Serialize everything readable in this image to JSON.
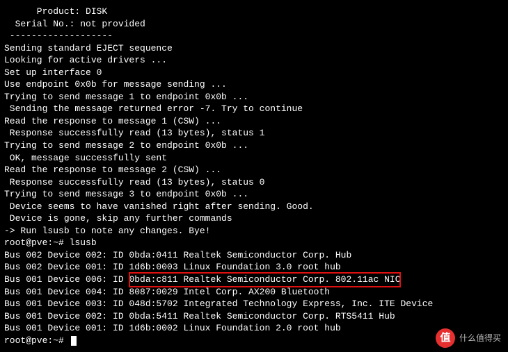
{
  "header": {
    "product": "      Product: DISK",
    "serial": "  Serial No.: not provided",
    "divider": " -------------------"
  },
  "log": [
    "Sending standard EJECT sequence",
    "Looking for active drivers ...",
    "Set up interface 0",
    "Use endpoint 0x0b for message sending ...",
    "Trying to send message 1 to endpoint 0x0b ...",
    " Sending the message returned error -7. Try to continue",
    "Read the response to message 1 (CSW) ...",
    " Response successfully read (13 bytes), status 1",
    "Trying to send message 2 to endpoint 0x0b ...",
    " OK, message successfully sent",
    "Read the response to message 2 (CSW) ...",
    " Response successfully read (13 bytes), status 0",
    "Trying to send message 3 to endpoint 0x0b ...",
    " Device seems to have vanished right after sending. Good.",
    " Device is gone, skip any further commands",
    "-> Run lsusb to note any changes. Bye!",
    ""
  ],
  "prompt1": {
    "prefix": "root@pve:~# ",
    "command": "lsusb"
  },
  "lsusb": {
    "r0": "Bus 002 Device 002: ID 0bda:0411 Realtek Semiconductor Corp. Hub",
    "r1": "Bus 002 Device 001: ID 1d6b:0003 Linux Foundation 3.0 root hub",
    "r2_prefix": "Bus 001 Device 006: ID ",
    "r2_hl": "0bda:c811 Realtek Semiconductor Corp. 802.11ac NIC",
    "r3": "Bus 001 Device 004: ID 8087:0029 Intel Corp. AX200 Bluetooth",
    "r4": "Bus 001 Device 003: ID 048d:5702 Integrated Technology Express, Inc. ITE Device",
    "r5": "Bus 001 Device 002: ID 0bda:5411 Realtek Semiconductor Corp. RTS5411 Hub",
    "r6": "Bus 001 Device 001: ID 1d6b:0002 Linux Foundation 2.0 root hub"
  },
  "prompt2": {
    "prefix": "root@pve:~# "
  },
  "watermark": {
    "badge": "值",
    "text": "什么值得买"
  }
}
